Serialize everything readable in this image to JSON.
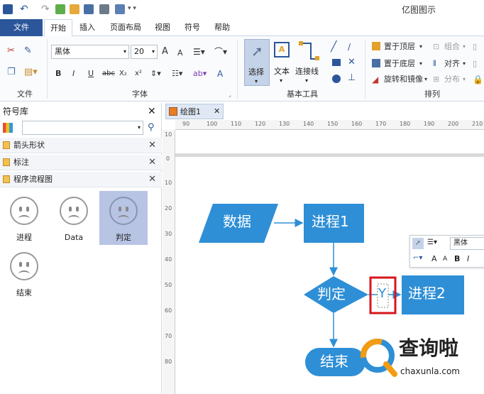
{
  "app": {
    "title": "亿图图示"
  },
  "menu": {
    "items": [
      "文件",
      "开始",
      "插入",
      "页面布局",
      "视图",
      "符号",
      "帮助"
    ]
  },
  "ribbon": {
    "font_name": "黑体",
    "font_size": "20",
    "groups": {
      "file": "文件",
      "font": "字体",
      "tools": "基本工具",
      "arrange": "排列"
    },
    "tools": {
      "select": "选择",
      "text": "文本",
      "connector": "连接线"
    },
    "arrange": {
      "bring_top": "置于顶层",
      "send_bottom": "置于底层",
      "rotate": "旋转和镜像",
      "group": "组合",
      "align": "对齐",
      "distribute": "分布"
    },
    "format_letters": {
      "bold": "B",
      "italic": "I",
      "underline": "U",
      "strike": "abc",
      "sub": "X₂",
      "sup": "x²",
      "grow": "A",
      "shrink": "A",
      "color": "A"
    }
  },
  "library": {
    "title": "符号库",
    "sections": [
      "箭头形状",
      "标注",
      "程序流程图"
    ],
    "shapes": [
      "进程",
      "Data",
      "判定",
      "结束"
    ]
  },
  "document": {
    "tab": "绘图1"
  },
  "ruler": {
    "h": [
      "90",
      "100",
      "110",
      "120",
      "130",
      "140",
      "150",
      "160",
      "170",
      "180",
      "190",
      "200",
      "210"
    ],
    "v": [
      "10",
      "0",
      "10",
      "20",
      "30",
      "40",
      "50",
      "60",
      "70",
      "80"
    ]
  },
  "flowchart": {
    "data": "数据",
    "process1": "进程1",
    "decision": "判定",
    "process2": "进程2",
    "end": "结束",
    "yes_label": "Y"
  },
  "minitoolbar": {
    "font": "黑体",
    "b": "B"
  },
  "watermark": {
    "brand": "查询啦",
    "url": "chaxunla.com"
  },
  "colors": {
    "accent": "#2b579a",
    "shape_fill": "#2e8fd6",
    "highlight": "#d6161b",
    "selected_bg": "#b8c4e4"
  }
}
